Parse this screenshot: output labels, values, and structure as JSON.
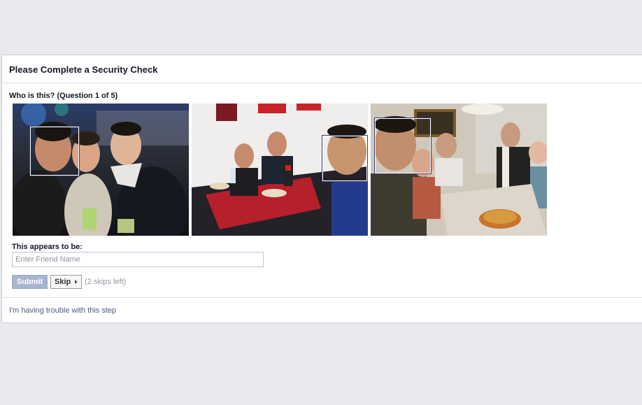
{
  "dialog": {
    "title": "Please Complete a Security Check",
    "question": "Who is this? (Question 1 of 5)",
    "photos": [
      {
        "name": "photo-concert-group"
      },
      {
        "name": "photo-restaurant-table"
      },
      {
        "name": "photo-dinner-party"
      }
    ],
    "answer_label": "This appears to be:",
    "input": {
      "value": "",
      "placeholder": "Enter Friend Name"
    },
    "submit_label": "Submit",
    "skip_label": "Skip",
    "skips_left": "(2 skips left)",
    "trouble_link": "I'm having trouble with this step"
  },
  "colors": {
    "page_bg": "#e9eaed",
    "submit_bg": "#a8b5d0",
    "link": "#4a5b7c"
  }
}
